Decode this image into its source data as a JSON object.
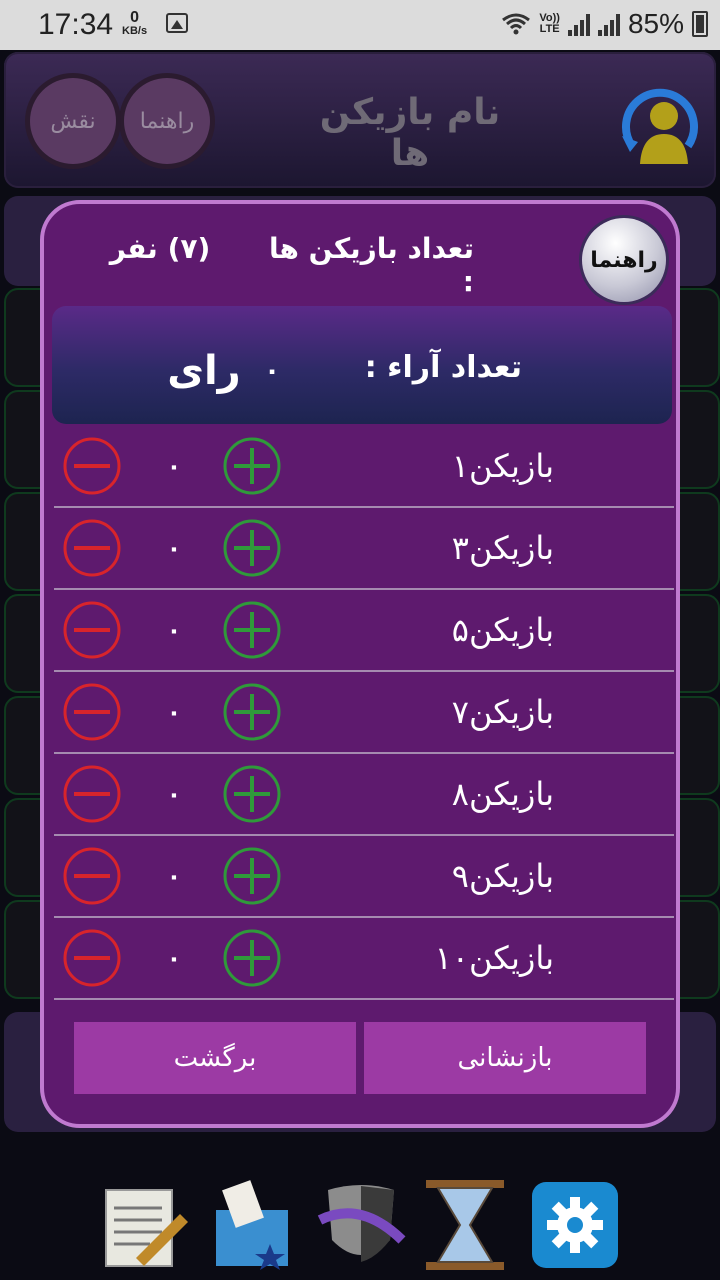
{
  "status_bar": {
    "time": "17:34",
    "net_speed_value": "0",
    "net_speed_unit": "KB/s",
    "network_label_top": "Vo))",
    "network_label_bottom": "LTE",
    "battery": "85%"
  },
  "header": {
    "title": "نام بازیکن ها",
    "help_button": "راهنما",
    "role_button": "نقش"
  },
  "dialog": {
    "help_button": "راهنما",
    "players_count_label": "تعداد بازیکن ها :",
    "players_count_value": "(۷) نفر",
    "votes_label": "تعداد آراء :",
    "votes_value": "۰",
    "votes_unit": "رای",
    "players": [
      {
        "name": "بازیکن۱",
        "votes": "۰"
      },
      {
        "name": "بازیکن۳",
        "votes": "۰"
      },
      {
        "name": "بازیکن۵",
        "votes": "۰"
      },
      {
        "name": "بازیکن۷",
        "votes": "۰"
      },
      {
        "name": "بازیکن۸",
        "votes": "۰"
      },
      {
        "name": "بازیکن۹",
        "votes": "۰"
      },
      {
        "name": "بازیکن۱۰",
        "votes": "۰"
      }
    ],
    "reset_button": "بازنشانی",
    "back_button": "برگشت"
  },
  "bottom_nav": [
    "notes-icon",
    "vote-box-icon",
    "mask-icon",
    "hourglass-icon",
    "gear-icon"
  ],
  "colors": {
    "dialog_bg": "#5e1a6e",
    "dialog_border": "#c07ad0",
    "plus": "#2f9a3a",
    "minus": "#d8242b",
    "button": "#9c3aa4"
  }
}
